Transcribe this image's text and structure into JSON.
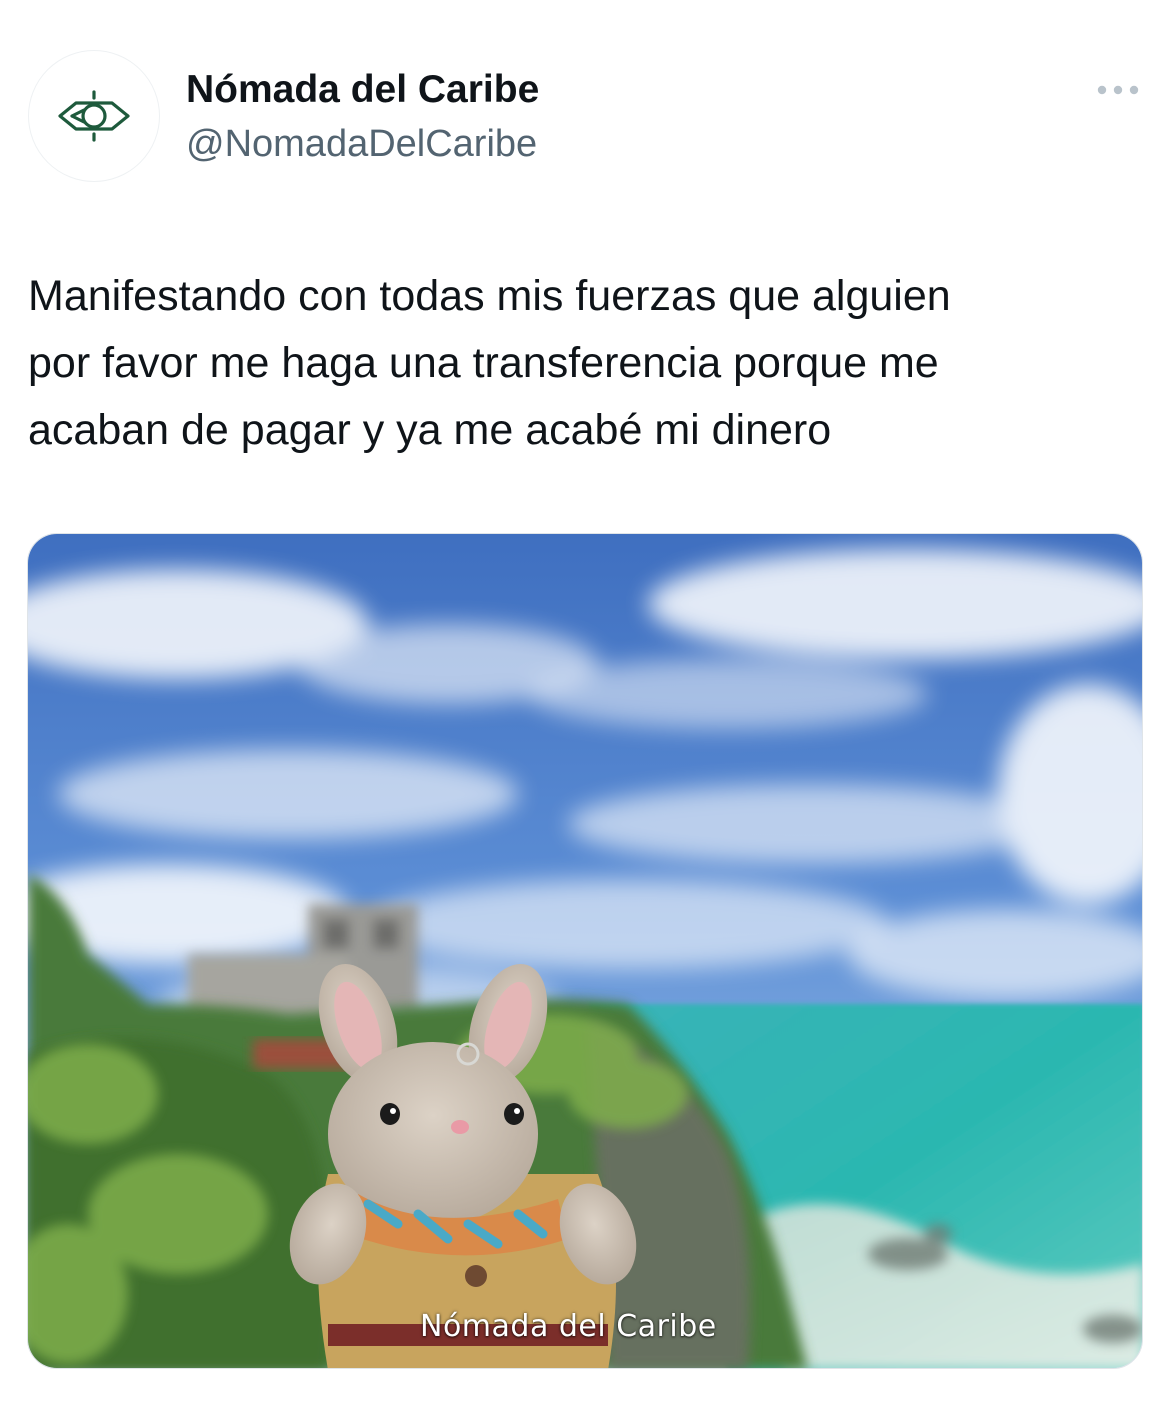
{
  "tweet": {
    "author": {
      "display_name": "Nómada del Caribe",
      "handle": "@NomadaDelCaribe",
      "avatar_icon": "eye-logo-icon",
      "brand_color": "#1e5a3c"
    },
    "more_icon": "more-dots-icon",
    "text_lines": [
      "Manifestando con todas mis fuerzas que alguien",
      "por favor me haga una transferencia porque me",
      "acaban de pagar y ya me acabé mi dinero"
    ],
    "media": {
      "watermark": "Nómada del Caribe"
    }
  },
  "colors": {
    "text_primary": "#0f1419",
    "text_secondary": "#536471",
    "background": "#ffffff"
  }
}
